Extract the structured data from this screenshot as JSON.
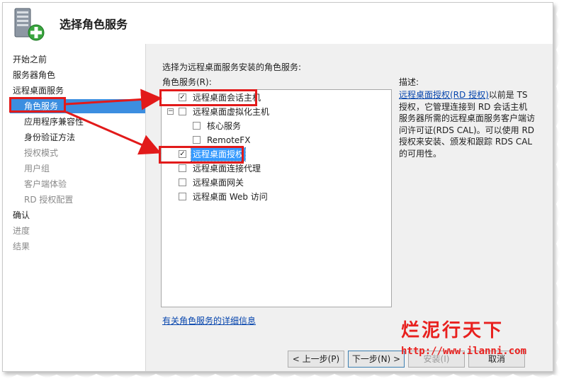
{
  "header": {
    "title": "选择角色服务",
    "icon": "server-add-icon"
  },
  "sidebar": {
    "items": [
      {
        "label": "开始之前",
        "level": 0,
        "state": "normal"
      },
      {
        "label": "服务器角色",
        "level": 0,
        "state": "normal"
      },
      {
        "label": "远程桌面服务",
        "level": 0,
        "state": "normal"
      },
      {
        "label": "角色服务",
        "level": 1,
        "state": "active"
      },
      {
        "label": "应用程序兼容性",
        "level": 1,
        "state": "normal"
      },
      {
        "label": "身份验证方法",
        "level": 1,
        "state": "normal"
      },
      {
        "label": "授权模式",
        "level": 1,
        "state": "disabled"
      },
      {
        "label": "用户组",
        "level": 1,
        "state": "disabled"
      },
      {
        "label": "客户端体验",
        "level": 1,
        "state": "disabled"
      },
      {
        "label": "RD 授权配置",
        "level": 1,
        "state": "disabled"
      },
      {
        "label": "确认",
        "level": 0,
        "state": "normal"
      },
      {
        "label": "进度",
        "level": 0,
        "state": "disabled"
      },
      {
        "label": "结果",
        "level": 0,
        "state": "disabled"
      }
    ]
  },
  "main": {
    "instruction": "选择为远程桌面服务安装的角色服务:",
    "list_label": "角色服务(R):",
    "role_services": [
      {
        "label": "远程桌面会话主机",
        "checked": true,
        "indent": 0
      },
      {
        "label": "远程桌面虚拟化主机",
        "checked": false,
        "indent": 0,
        "expander": "⊟"
      },
      {
        "label": "核心服务",
        "checked": false,
        "indent": 1
      },
      {
        "label": "RemoteFX",
        "checked": false,
        "indent": 1
      },
      {
        "label": "远程桌面授权",
        "checked": true,
        "indent": 0,
        "selected": true
      },
      {
        "label": "远程桌面连接代理",
        "checked": false,
        "indent": 0
      },
      {
        "label": "远程桌面网关",
        "checked": false,
        "indent": 0
      },
      {
        "label": "远程桌面 Web 访问",
        "checked": false,
        "indent": 0
      }
    ],
    "more_info_link": "有关角色服务的详细信息",
    "description_label": "描述:",
    "description_link": "远程桌面授权(RD 授权)",
    "description_text": "以前是 TS 授权，它管理连接到 RD 会话主机服务器所需的远程桌面服务客户端访问许可证(RDS CAL)。可以使用 RD 授权来安装、颁发和跟踪 RDS CAL 的可用性。"
  },
  "buttons": {
    "prev": "< 上一步(P)",
    "next": "下一步(N) >",
    "install": "安装(I)",
    "cancel": "取消"
  },
  "watermark": {
    "brand": "烂泥行天下",
    "url": "http://www.ilanni.com"
  },
  "colors": {
    "selection": "#3c8ee0",
    "annotation_red": "#e21a1a",
    "link": "#0645ad"
  }
}
